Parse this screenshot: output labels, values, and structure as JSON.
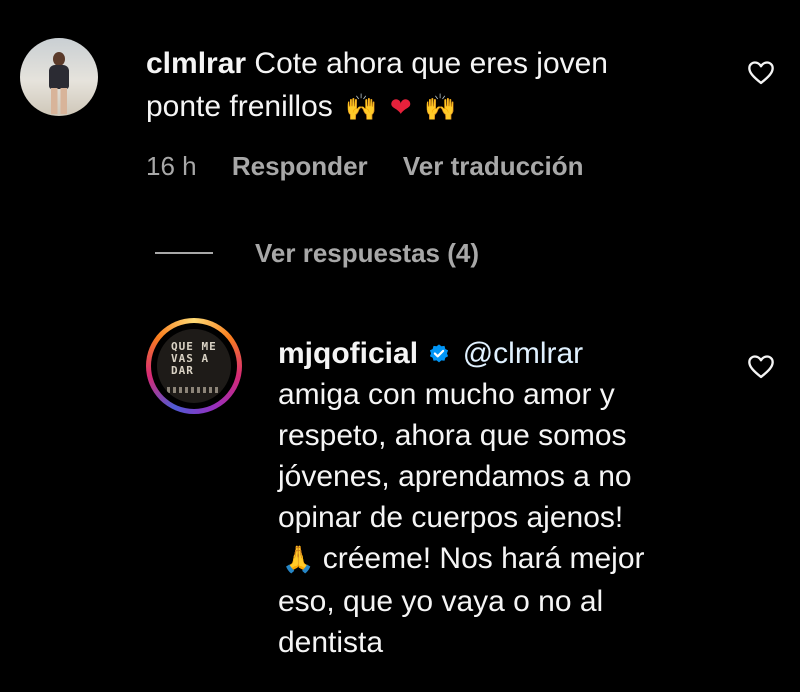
{
  "comment1": {
    "username": "clmlrar",
    "text_line1": "Cote ahora que eres joven",
    "text_line2": "ponte frenillos",
    "emojis": [
      "🙌",
      "❤",
      "🙌"
    ],
    "time": "16 h",
    "reply_label": "Responder",
    "translate_label": "Ver traducción",
    "icons": {
      "like": "heart-outline-icon"
    }
  },
  "replies_toggle": {
    "label": "Ver respuestas (4)"
  },
  "comment2": {
    "username": "mjqoficial",
    "mention": "@clmlrar",
    "text_lines": [
      "amiga con mucho amor y",
      "respeto, ahora que somos",
      "jóvenes, aprendamos a no",
      "opinar de cuerpos ajenos!"
    ],
    "emoji": "🙏",
    "text_line5": "créeme! Nos hará mejor",
    "text_line6": "eso, que yo vaya o no al",
    "text_line7": "dentista",
    "avatar_logo_text": "QUE ME VAS A DAR",
    "icons": {
      "verified": "verified-badge-icon",
      "like": "heart-outline-icon"
    }
  },
  "colors": {
    "background": "#000000",
    "text": "#f5f5f5",
    "secondary": "#a8a8a8",
    "verified": "#0095f6",
    "heart_emoji": "#e6213b"
  }
}
